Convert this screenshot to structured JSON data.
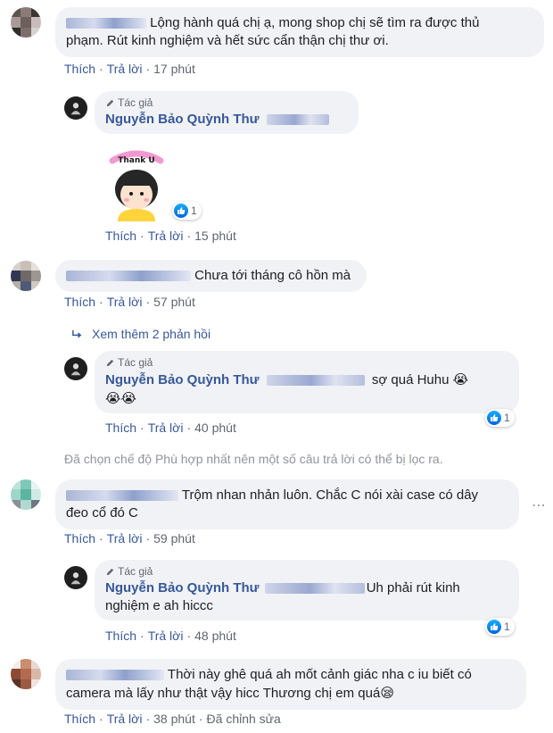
{
  "comments": [
    {
      "text": "Lộng hành quá chị ạ, mong shop chị sẽ tìm ra được thủ phạm. Rút kinh nghiệm và hết sức cẩn thận chị thư ơi.",
      "line1": "Lộng hành quá chị ạ, mong shop chị sẽ tìm ra được thủ",
      "line2": "phạm. Rút kinh nghiệm và hết sức cẩn thận chị thư ơi.",
      "like": "Thích",
      "reply": "Trả lời",
      "time": "17 phút"
    },
    {
      "text": "Chưa tới tháng cô hồn mà",
      "like": "Thích",
      "reply": "Trả lời",
      "time": "57 phút"
    },
    {
      "text": "Trộm nhan nhản luôn. Chắc C nói xài case có dây đeo cổ đó C",
      "line1": "Trộm nhan nhản luôn. Chắc C nói xài case có dây",
      "line2": "đeo cổ đó C",
      "like": "Thích",
      "reply": "Trả lời",
      "time": "59 phút"
    },
    {
      "text": "Thời này ghê quá ah mốt cảnh giác nha c iu biết có camera mà lấy như thật vậy hicc Thương chị em quá",
      "line1": "Thời này ghê quá ah mốt cảnh giác nha c iu biết có",
      "line2": "camera mà lấy như thật vậy hicc Thương chị em quá",
      "emoji": "😪",
      "like": "Thích",
      "reply": "Trả lời",
      "time": "38 phút",
      "edited": "Đã chỉnh sửa"
    }
  ],
  "author_replies": [
    {
      "author_tag": "Tác giả",
      "name": "Nguyễn Bảo Quỳnh Thư",
      "sticker_text": "Thank U",
      "reaction_count": "1",
      "like": "Thích",
      "reply": "Trả lời",
      "time": "15 phút"
    },
    {
      "author_tag": "Tác giả",
      "name": "Nguyễn Bảo Quỳnh Thư",
      "text": "sợ quá Huhu",
      "emoji_inline": "😭",
      "emoji_line2": "😭😭",
      "reaction_count": "1",
      "like": "Thích",
      "reply": "Trả lời",
      "time": "40 phút"
    },
    {
      "author_tag": "Tác giả",
      "name": "Nguyễn Bảo Quỳnh Thư",
      "line1": "Uh phải rút kinh",
      "line2": "nghiệm e ah hiccc",
      "reaction_count": "1",
      "like": "Thích",
      "reply": "Trả lời",
      "time": "48 phút"
    }
  ],
  "more_replies": "Xem thêm 2 phản hồi",
  "filter_note": "Đã chọn chế độ Phù hợp nhất nên một số câu trả lời có thể bị lọc ra.",
  "separator": "·",
  "more_icon": "ellipsis-icon",
  "colors": {
    "link": "#385898",
    "bubble": "#f0f2f5",
    "meta": "#606770",
    "like_blue": "#0062df"
  }
}
